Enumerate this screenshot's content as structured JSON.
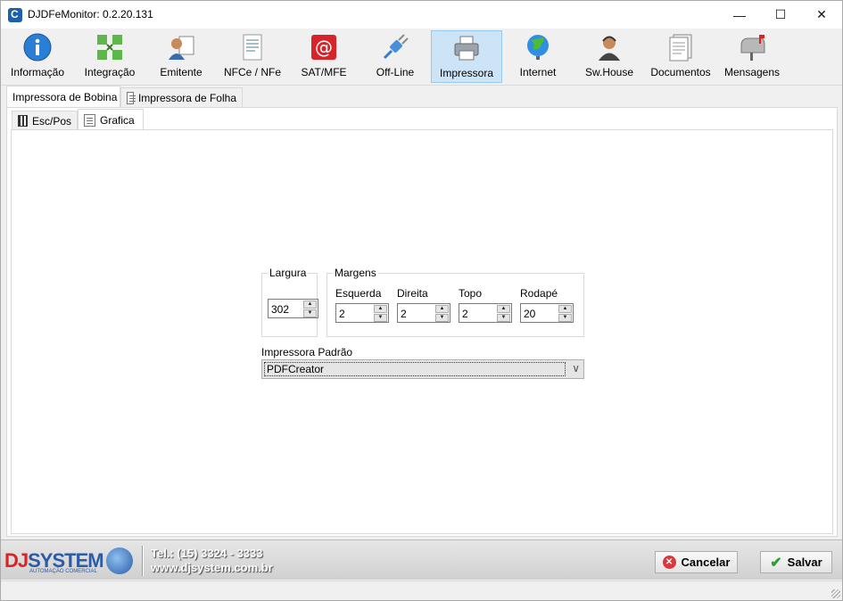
{
  "window": {
    "title": "DJDFeMonitor: 0.2.20.131"
  },
  "toolbar": {
    "items": [
      {
        "label": "Informação",
        "icon": "info-icon"
      },
      {
        "label": "Integração",
        "icon": "integration-icon"
      },
      {
        "label": "Emitente",
        "icon": "issuer-icon"
      },
      {
        "label": "NFCe / NFe",
        "icon": "invoice-icon"
      },
      {
        "label": "SAT/MFE",
        "icon": "sat-icon"
      },
      {
        "label": "Off-Line",
        "icon": "offline-plug-icon"
      },
      {
        "label": "Impressora",
        "icon": "printer-icon",
        "active": true
      },
      {
        "label": "Internet",
        "icon": "globe-icon"
      },
      {
        "label": "Sw.House",
        "icon": "support-agent-icon"
      },
      {
        "label": "Documentos",
        "icon": "documents-icon"
      },
      {
        "label": "Mensagens",
        "icon": "mailbox-icon"
      }
    ]
  },
  "tabs_outer": [
    "Impressora de Bobina",
    "Impressora de Folha"
  ],
  "tabs_inner": [
    "Esc/Pos",
    "Grafica"
  ],
  "largura": {
    "legend": "Largura",
    "value": "302"
  },
  "margens": {
    "legend": "Margens",
    "esquerda": {
      "label": "Esquerda",
      "value": "2"
    },
    "direita": {
      "label": "Direita",
      "value": "2"
    },
    "topo": {
      "label": "Topo",
      "value": "2"
    },
    "rodape": {
      "label": "Rodapé",
      "value": "20"
    }
  },
  "impressora_padrao": {
    "label": "Impressora Padrão",
    "value": "PDFCreator"
  },
  "footer": {
    "brand_dj": "DJ",
    "brand_system": "SYSTEM",
    "brand_sub": "AUTOMAÇÃO COMERCIAL",
    "phone": "Tel.: (15) 3324 - 3333",
    "site": "www.djsystem.com.br",
    "cancel_label": "Cancelar",
    "save_label": "Salvar"
  },
  "colors": {
    "accent": "#cde4f7",
    "brand_blue": "#2a5ca8",
    "brand_red": "#dd2222"
  }
}
